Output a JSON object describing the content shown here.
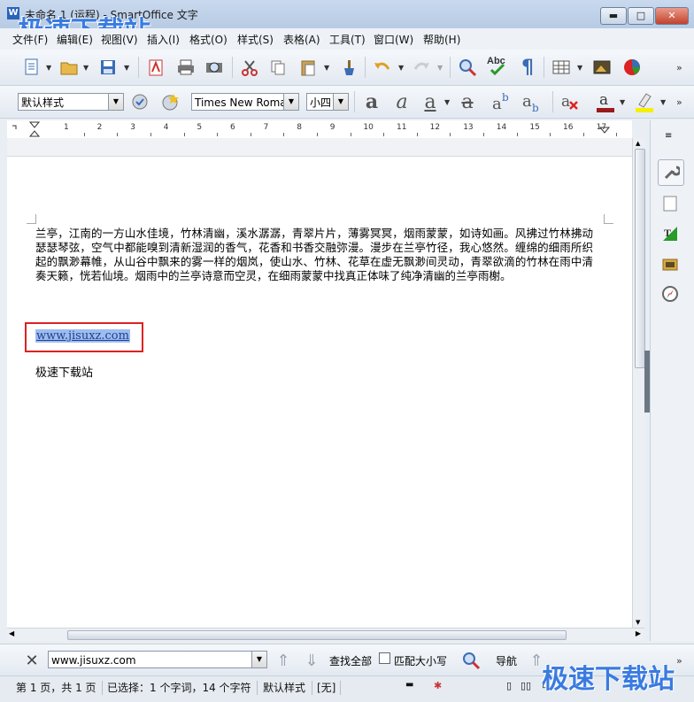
{
  "window": {
    "title": "未命名 1 (运程) - SmartOffice 文字",
    "app_icon_letter": "W",
    "minimize_glyph": "▬",
    "maximize_glyph": "□",
    "close_glyph": "✕"
  },
  "watermark": {
    "text": "极速下载站"
  },
  "menu": [
    "文件(F)",
    "编辑(E)",
    "视图(V)",
    "插入(I)",
    "格式(O)",
    "样式(S)",
    "表格(A)",
    "工具(T)",
    "窗口(W)",
    "帮助(H)"
  ],
  "format_toolbar": {
    "style_value": "默认样式",
    "font_value": "Times New Roma",
    "size_value": "小四"
  },
  "ruler": {
    "numbers": [
      "1",
      "2",
      "3",
      "4",
      "5",
      "6",
      "7",
      "8",
      "9",
      "10",
      "11",
      "12",
      "13",
      "14",
      "15",
      "16",
      "17"
    ]
  },
  "document": {
    "paragraph": "兰亭，江南的一方山水佳境，竹林清幽，溪水潺潺，青翠片片，薄雾冥冥，烟雨蒙蒙，如诗如画。风拂过竹林拂动瑟瑟琴弦，空气中都能嗅到清新湿润的香气，花香和书香交融弥漫。漫步在兰亭竹径，我心悠然。缠绵的细雨所织起的飘渺幕帷，从山谷中飘来的雾一样的烟岚，使山水、竹林、花草在虚无飘渺间灵动，青翠欲滴的竹林在雨中清奏天籁，恍若仙境。烟雨中的兰亭诗意而空灵，在细雨蒙蒙中找真正体味了纯净清幽的兰亭雨榭。",
    "link": "www.jisuxz.com",
    "site_name": "极速下载站"
  },
  "findbar": {
    "search_value": "www.jisuxz.com",
    "find_all_label": "查找全部",
    "match_case_label": "匹配大小写",
    "navigate_label": "导航"
  },
  "status": {
    "page": "第 1 页，共 1 页",
    "selection": "已选择：1 个字词，14 个字符",
    "style": "默认样式",
    "lang": "[无]"
  }
}
